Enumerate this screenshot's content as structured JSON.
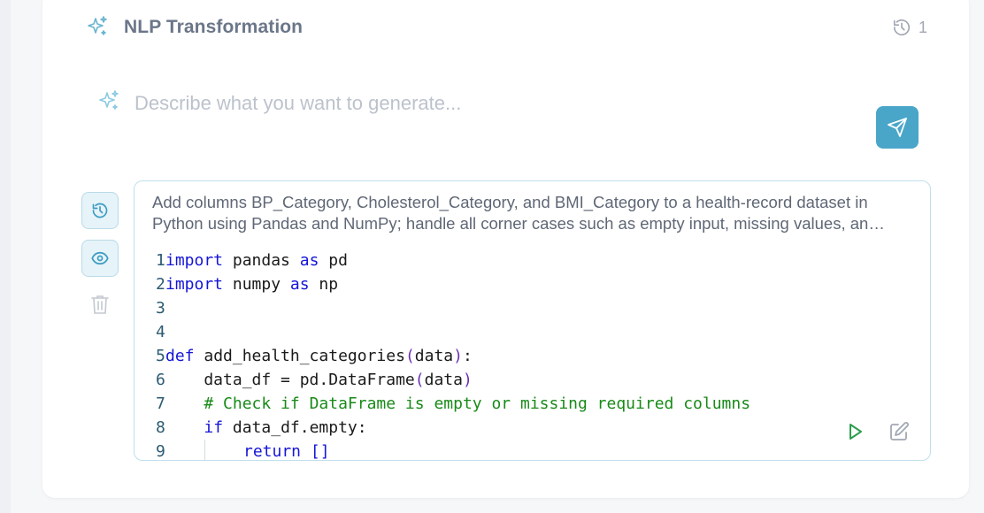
{
  "header": {
    "title": "NLP Transformation",
    "history_count": "1"
  },
  "prompt": {
    "placeholder": "Describe what you want to generate..."
  },
  "result": {
    "description": "Add columns BP_Category, Cholesterol_Category, and BMI_Category to a health-record dataset in Python using Pandas and NumPy; handle all corner cases such as empty input, missing values, and invalid data.",
    "code": {
      "l1": {
        "n": "1",
        "kw": "import",
        "rest": " pandas ",
        "kw2": "as",
        "rest2": " pd"
      },
      "l2": {
        "n": "2",
        "kw": "import",
        "rest": " numpy ",
        "kw2": "as",
        "rest2": " np"
      },
      "l3": {
        "n": "3"
      },
      "l4": {
        "n": "4"
      },
      "l5": {
        "n": "5",
        "kw": "def",
        "name": " add_health_categories",
        "open": "(",
        "arg": "data",
        "close": ")",
        "end": ":"
      },
      "l6": {
        "n": "6",
        "pre": "    data_df = pd.DataFrame",
        "open": "(",
        "arg": "data",
        "close": ")"
      },
      "l7": {
        "n": "7",
        "comment": "# Check if DataFrame is empty or missing required columns"
      },
      "l8": {
        "n": "8",
        "kw": "if",
        "rest": " data_df.empty:"
      },
      "l9": {
        "n": "9",
        "kw": "return",
        "brackets": " []"
      }
    }
  },
  "colors": {
    "accent": "#4aa6c9",
    "keyword": "#1515d8",
    "comment": "#188a18"
  },
  "icons": {
    "header": "sparkle-icon",
    "history": "history-icon",
    "prompt": "sparkle-icon",
    "send": "send-icon",
    "side_history": "history-icon",
    "side_view": "eye-icon",
    "side_delete": "trash-icon",
    "run": "play-icon",
    "edit": "edit-icon"
  }
}
